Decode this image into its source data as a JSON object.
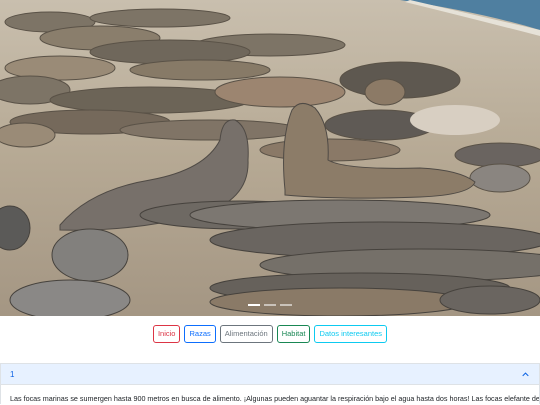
{
  "hero": {
    "image_alt": "Elefantes marinos descansando en la playa",
    "slide_count": 3,
    "active_slide": 1
  },
  "nav": {
    "buttons": [
      {
        "label": "Inicio",
        "style": "danger"
      },
      {
        "label": "Razas",
        "style": "primary"
      },
      {
        "label": "Alimentación",
        "style": "secondary"
      },
      {
        "label": "Habitat",
        "style": "success"
      },
      {
        "label": "Datos interesantes",
        "style": "info"
      }
    ]
  },
  "accordion": {
    "item_title": "1",
    "expanded": true,
    "body_text": "Las focas marinas se sumergen hasta 900 metros en busca de alimento. ¡Algunas pueden aguantar la respiración bajo el agua hasta dos horas! Las focas elefante del"
  },
  "colors": {
    "danger": "#dc3545",
    "primary": "#0d6efd",
    "secondary": "#6c757d",
    "success": "#198754",
    "info": "#0dcaf0",
    "accordion_header_bg": "#e7f1ff"
  }
}
